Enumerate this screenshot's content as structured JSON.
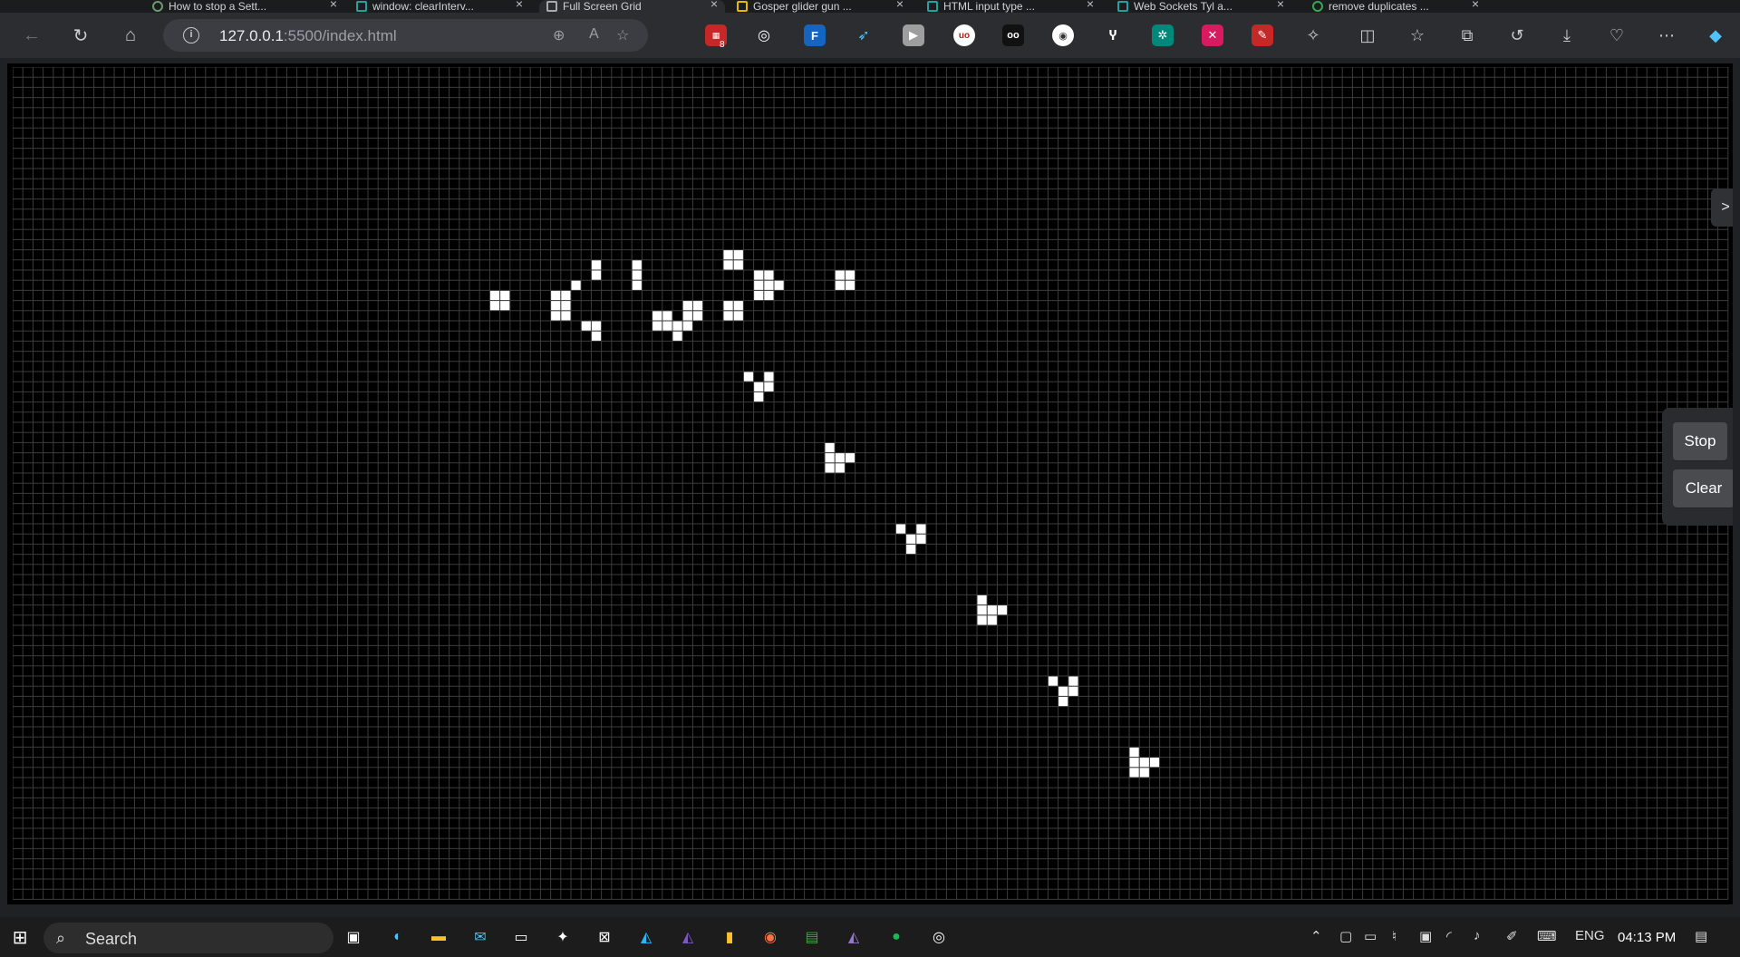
{
  "browser": {
    "tabs": [
      {
        "title": "How to stop a Sett...",
        "active": false
      },
      {
        "title": "window: clearInterv...",
        "active": false
      },
      {
        "title": "Full Screen Grid",
        "active": true
      },
      {
        "title": "Gosper glider gun ...",
        "active": false
      },
      {
        "title": "HTML input type ...",
        "active": false
      },
      {
        "title": "Web Sockets Tyl a...",
        "active": false
      },
      {
        "title": "remove duplicates ...",
        "active": false
      }
    ],
    "url_host": "127.0.0.1",
    "url_path": ":5500/index.html",
    "ext_badge": "8"
  },
  "grid": {
    "cell_color": "#ffffff",
    "background": "#000000",
    "line_color": "#3c3c3c",
    "cols": 169,
    "rows": 82,
    "live_cells": [
      [
        47,
        22
      ],
      [
        48,
        22
      ],
      [
        47,
        23
      ],
      [
        48,
        23
      ],
      [
        53,
        22
      ],
      [
        54,
        22
      ],
      [
        53,
        23
      ],
      [
        54,
        23
      ],
      [
        53,
        24
      ],
      [
        54,
        24
      ],
      [
        55,
        21
      ],
      [
        56,
        25
      ],
      [
        57,
        20
      ],
      [
        57,
        19
      ],
      [
        57,
        26
      ],
      [
        57,
        25
      ],
      [
        61,
        19
      ],
      [
        61,
        20
      ],
      [
        61,
        21
      ],
      [
        63,
        24
      ],
      [
        64,
        24
      ],
      [
        63,
        25
      ],
      [
        64,
        25
      ],
      [
        65,
        25
      ],
      [
        66,
        25
      ],
      [
        65,
        26
      ],
      [
        66,
        24
      ],
      [
        67,
        24
      ],
      [
        67,
        23
      ],
      [
        66,
        23
      ],
      [
        70,
        18
      ],
      [
        71,
        18
      ],
      [
        70,
        19
      ],
      [
        71,
        19
      ],
      [
        70,
        23
      ],
      [
        71,
        23
      ],
      [
        70,
        24
      ],
      [
        71,
        24
      ],
      [
        73,
        20
      ],
      [
        74,
        20
      ],
      [
        73,
        21
      ],
      [
        74,
        21
      ],
      [
        75,
        21
      ],
      [
        73,
        22
      ],
      [
        74,
        22
      ],
      [
        81,
        20
      ],
      [
        82,
        20
      ],
      [
        81,
        21
      ],
      [
        82,
        21
      ],
      [
        72,
        30
      ],
      [
        74,
        30
      ],
      [
        73,
        31
      ],
      [
        74,
        31
      ],
      [
        73,
        32
      ],
      [
        80,
        37
      ],
      [
        80,
        38
      ],
      [
        81,
        38
      ],
      [
        82,
        38
      ],
      [
        80,
        39
      ],
      [
        81,
        39
      ],
      [
        87,
        45
      ],
      [
        88,
        46
      ],
      [
        89,
        45
      ],
      [
        89,
        46
      ],
      [
        88,
        47
      ],
      [
        95,
        52
      ],
      [
        95,
        53
      ],
      [
        96,
        53
      ],
      [
        97,
        53
      ],
      [
        95,
        54
      ],
      [
        96,
        54
      ],
      [
        102,
        60
      ],
      [
        103,
        61
      ],
      [
        104,
        60
      ],
      [
        104,
        61
      ],
      [
        103,
        62
      ],
      [
        110,
        67
      ],
      [
        110,
        68
      ],
      [
        111,
        68
      ],
      [
        112,
        68
      ],
      [
        110,
        69
      ],
      [
        111,
        69
      ]
    ]
  },
  "controls": {
    "toggle_label": ">",
    "stop_label": "Stop",
    "clear_label": "Clear"
  },
  "taskbar": {
    "search_placeholder": "Search",
    "language": "ENG",
    "time": "04:13 PM"
  }
}
